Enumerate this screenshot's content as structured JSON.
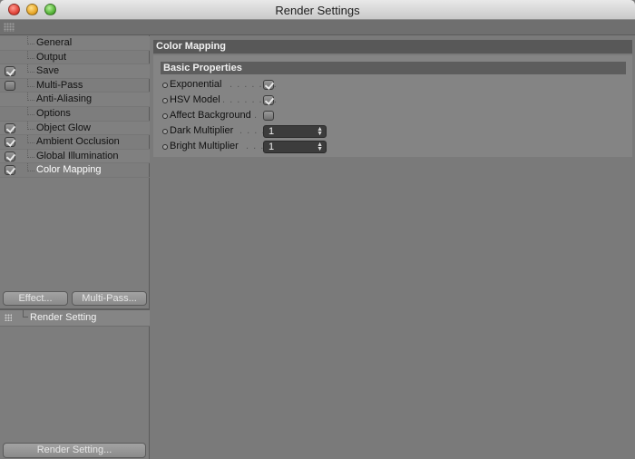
{
  "window": {
    "title": "Render Settings"
  },
  "nav": {
    "items": [
      {
        "label": "General",
        "checkbox": "none"
      },
      {
        "label": "Output",
        "checkbox": "none"
      },
      {
        "label": "Save",
        "checkbox": "checked"
      },
      {
        "label": "Multi-Pass",
        "checkbox": "unchecked"
      },
      {
        "label": "Anti-Aliasing",
        "checkbox": "none"
      },
      {
        "label": "Options",
        "checkbox": "none"
      },
      {
        "label": "Object Glow",
        "checkbox": "checked"
      },
      {
        "label": "Ambient Occlusion",
        "checkbox": "checked"
      },
      {
        "label": "Global Illumination",
        "checkbox": "checked"
      },
      {
        "label": "Color Mapping",
        "checkbox": "checked",
        "active": true
      }
    ]
  },
  "buttons": {
    "effect": "Effect...",
    "multipass": "Multi-Pass...",
    "render_setting": "Render Setting..."
  },
  "settings_list": {
    "item": "Render Setting"
  },
  "main": {
    "section_title": "Color Mapping",
    "group_title": "Basic Properties",
    "props": {
      "exponential": {
        "label": "Exponential",
        "dots": ". . . . . . .",
        "checked": true
      },
      "hsv_model": {
        "label": "HSV Model",
        "dots": ". . . . . . . .",
        "checked": true
      },
      "affect_background": {
        "label": "Affect Background",
        "dots": ".",
        "checked": false
      },
      "dark_multiplier": {
        "label": "Dark Multiplier",
        "dots": ". . . .",
        "value": "1"
      },
      "bright_multiplier": {
        "label": "Bright Multiplier",
        "dots": ". . .",
        "value": "1"
      }
    }
  }
}
